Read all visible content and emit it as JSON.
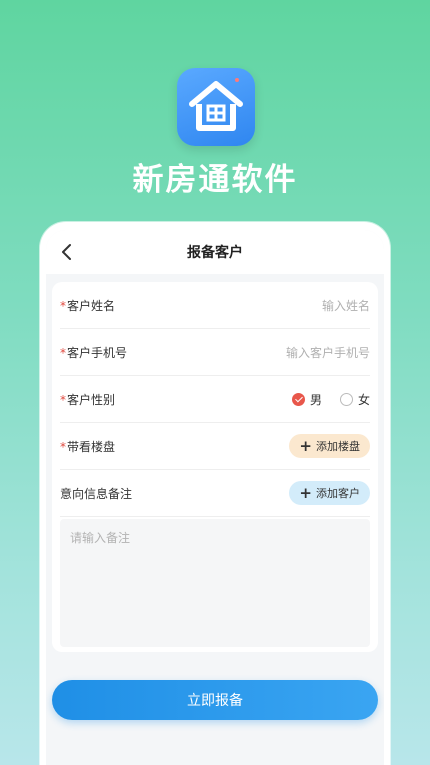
{
  "app": {
    "name": "新房通软件"
  },
  "screen": {
    "title": "报备客户"
  },
  "form": {
    "name": {
      "required_mark": "*",
      "label": "客户姓名",
      "placeholder": "输入姓名"
    },
    "phone": {
      "required_mark": "*",
      "label": "客户手机号",
      "placeholder": "输入客户手机号"
    },
    "gender": {
      "required_mark": "*",
      "label": "客户性别",
      "options": [
        "男",
        "女"
      ],
      "selected": "男"
    },
    "property": {
      "required_mark": "*",
      "label": "带看楼盘",
      "add_label": "添加楼盘"
    },
    "notes": {
      "label": "意向信息备注",
      "add_label": "添加客户",
      "placeholder": "请输入备注"
    }
  },
  "submit_label": "立即报备",
  "colors": {
    "accent": "#2f96ea",
    "required": "#e04a3f",
    "radio_on": "#e8574b"
  },
  "icons": [
    "house-icon",
    "back-arrow-icon",
    "plus-icon"
  ]
}
